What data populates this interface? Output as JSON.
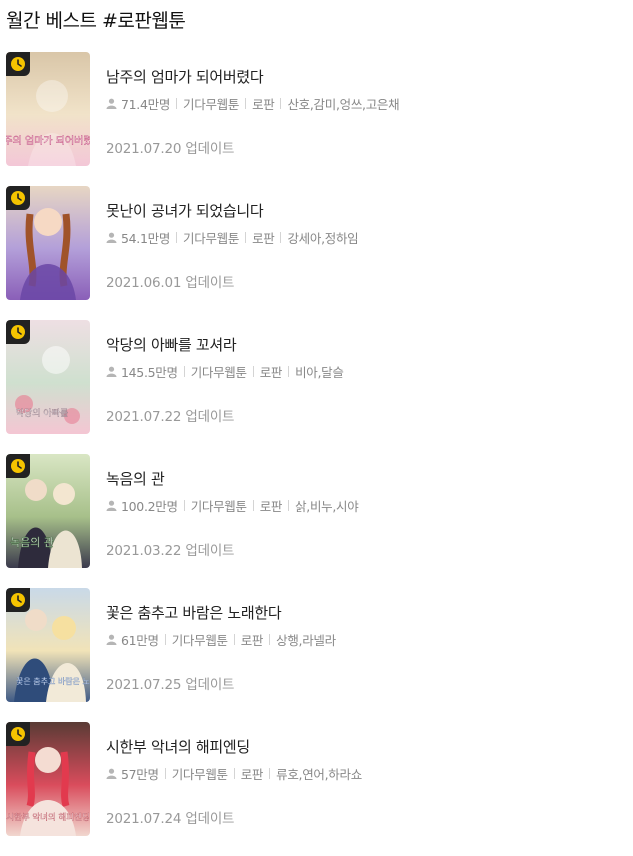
{
  "section_title": "월간 베스트 #로판웹툰",
  "items": [
    {
      "title": "남주의 엄마가 되어버렸다",
      "views": "71.4만명",
      "platform": "기다무웹툰",
      "genre": "로판",
      "authors": "산호,감미,엉쓰,고은채",
      "updated": "2021.07.20 업데이트",
      "cover_text": "남주의 엄마가 되어버렸다",
      "colors": [
        "#d9c6a8",
        "#f1e3c9",
        "#f3c7d7"
      ]
    },
    {
      "title": "못난이 공녀가 되었습니다",
      "views": "54.1만명",
      "platform": "기다무웹툰",
      "genre": "로판",
      "authors": "강세아,정하임",
      "updated": "2021.06.01 업데이트",
      "cover_text": "",
      "colors": [
        "#e7d6c3",
        "#b39fd9",
        "#8a5fb8"
      ]
    },
    {
      "title": "악당의 아빠를 꼬셔라",
      "views": "145.5만명",
      "platform": "기다무웹툰",
      "genre": "로판",
      "authors": "비아,달슬",
      "updated": "2021.07.22 업데이트",
      "cover_text": "악당의 아빠를",
      "colors": [
        "#eedfe3",
        "#cfe0cf",
        "#f4c6d3"
      ]
    },
    {
      "title": "녹음의 관",
      "views": "100.2만명",
      "platform": "기다무웹툰",
      "genre": "로판",
      "authors": "삵,비누,시야",
      "updated": "2021.03.22 업데이트",
      "cover_text": "녹음의 관",
      "colors": [
        "#d9e6c4",
        "#a7c08a",
        "#3b3a4d"
      ]
    },
    {
      "title": "꽃은 춤추고 바람은 노래한다",
      "views": "61만명",
      "platform": "기다무웹툰",
      "genre": "로판",
      "authors": "상행,라넬라",
      "updated": "2021.07.25 업데이트",
      "cover_text": "꽃은 춤추고 바람은 노래한다",
      "colors": [
        "#c9d9e8",
        "#f1e3b8",
        "#3f5a86"
      ]
    },
    {
      "title": "시한부 악녀의 해피엔딩",
      "views": "57만명",
      "platform": "기다무웹툰",
      "genre": "로판",
      "authors": "류호,연어,하라쇼",
      "updated": "2021.07.24 업데이트",
      "cover_text": "시한부 악녀의 해피엔딩",
      "colors": [
        "#5a3b35",
        "#d94c5c",
        "#f1d7cf"
      ]
    }
  ],
  "icons": {
    "badge": "clock-icon",
    "views": "user-icon"
  },
  "accent": {
    "badge_bg": "#222222",
    "badge_fg": "#f5c400"
  }
}
